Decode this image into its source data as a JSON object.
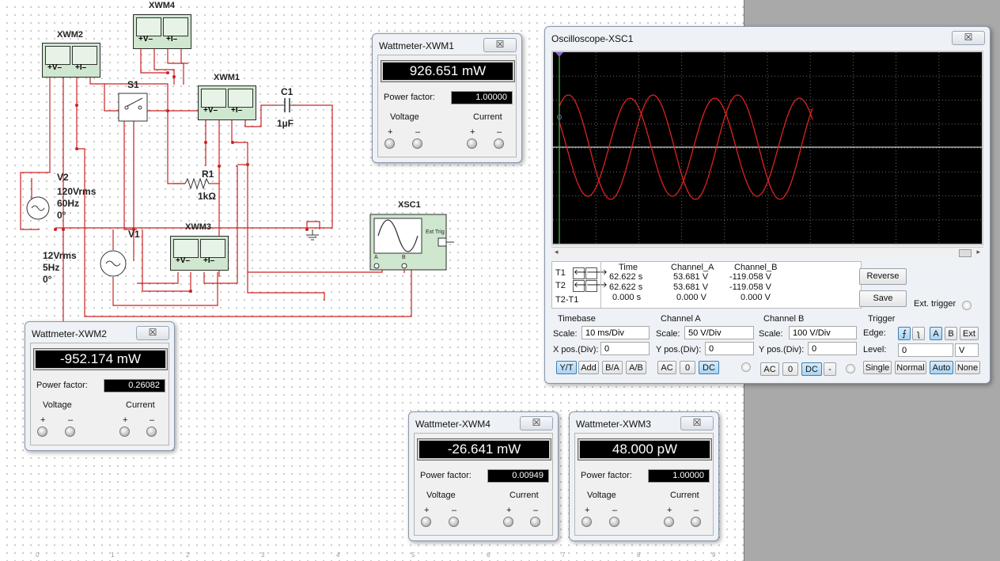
{
  "circuit": {
    "labels": {
      "xwm4": "XWM4",
      "xwm2": "XWM2",
      "xwm1": "XWM1",
      "xwm3": "XWM3",
      "s1": "S1",
      "c1_name": "C1",
      "c1_value": "1µF",
      "r1_name": "R1",
      "r1_value": "1kΩ",
      "v2_name": "V2",
      "v2_amp": "120Vrms",
      "v2_freq": "60Hz",
      "v2_phase": "0°",
      "v1_name": "V1",
      "v1_amp": "12Vrms",
      "v1_freq": "5Hz",
      "v1_phase": "0°",
      "xsc1": "XSC1",
      "ext_trig": "Ext Trig",
      "scope_a": "A",
      "scope_b": "B"
    },
    "meter_symbols": {
      "plus_v_minus": "+V–",
      "plus_i_minus": "+I–"
    },
    "ruler": [
      "0",
      "1",
      "2",
      "3",
      "4",
      "5",
      "6",
      "7",
      "8",
      "9"
    ],
    "wire_color": "#cc2222"
  },
  "wattmeters": {
    "xwm1": {
      "title": "Wattmeter-XWM1",
      "reading": "926.651 mW",
      "pf_label": "Power factor:",
      "pf": "1.00000",
      "voltage": "Voltage",
      "current": "Current",
      "plus": "+",
      "minus": "–",
      "close": "☒"
    },
    "xwm2": {
      "title": "Wattmeter-XWM2",
      "reading": "-952.174 mW",
      "pf_label": "Power factor:",
      "pf": "0.26082",
      "voltage": "Voltage",
      "current": "Current",
      "plus": "+",
      "minus": "–",
      "close": "☒"
    },
    "xwm4": {
      "title": "Wattmeter-XWM4",
      "reading": "-26.641 mW",
      "pf_label": "Power factor:",
      "pf": "0.00949",
      "voltage": "Voltage",
      "current": "Current",
      "plus": "+",
      "minus": "–",
      "close": "☒"
    },
    "xwm3": {
      "title": "Wattmeter-XWM3",
      "reading": "48.000 pW",
      "pf_label": "Power factor:",
      "pf": "1.00000",
      "voltage": "Voltage",
      "current": "Current",
      "plus": "+",
      "minus": "–",
      "close": "☒"
    }
  },
  "oscilloscope": {
    "title": "Oscilloscope-XSC1",
    "close": "☒",
    "trace_color": "#dd2222",
    "cursor_color": "#44cc44",
    "table": {
      "headers": [
        "Time",
        "Channel_A",
        "Channel_B"
      ],
      "rows": [
        {
          "label": "T1",
          "time": "62.622 s",
          "a": "53.681 V",
          "b": "-119.058 V"
        },
        {
          "label": "T2",
          "time": "62.622 s",
          "a": "53.681 V",
          "b": "-119.058 V"
        },
        {
          "label": "T2-T1",
          "time": "0.000 s",
          "a": "0.000 V",
          "b": "0.000 V"
        }
      ]
    },
    "reverse": "Reverse",
    "save": "Save",
    "ext_trigger": "Ext. trigger",
    "timebase": {
      "title": "Timebase",
      "scale_label": "Scale:",
      "scale": "10 ms/Div",
      "xpos_label": "X pos.(Div):",
      "xpos": "0",
      "buttons": [
        "Y/T",
        "Add",
        "B/A",
        "A/B"
      ],
      "active": "Y/T"
    },
    "channel_a": {
      "title": "Channel A",
      "scale_label": "Scale:",
      "scale": "50  V/Div",
      "ypos_label": "Y pos.(Div):",
      "ypos": "0",
      "buttons": [
        "AC",
        "0",
        "DC"
      ],
      "active": "DC"
    },
    "channel_b": {
      "title": "Channel B",
      "scale_label": "Scale:",
      "scale": "100  V/Div",
      "ypos_label": "Y pos.(Div):",
      "ypos": "0",
      "buttons": [
        "AC",
        "0",
        "DC",
        "-"
      ],
      "active": "DC"
    },
    "trigger": {
      "title": "Trigger",
      "edge_label": "Edge:",
      "edge_rise": "⨍",
      "edge_fall": "ʅ",
      "src_a": "A",
      "src_b": "B",
      "src_ext": "Ext",
      "level_label": "Level:",
      "level": "0",
      "level_unit": "V",
      "modes": [
        "Single",
        "Normal",
        "Auto",
        "None"
      ],
      "active_mode": "Auto"
    }
  }
}
